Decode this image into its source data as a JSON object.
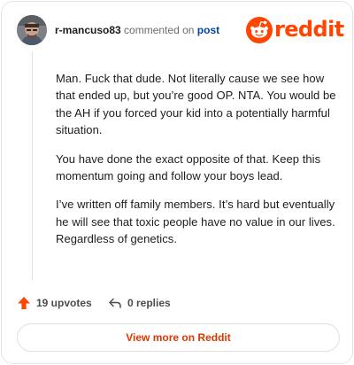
{
  "comment": {
    "username": "r-mancuso83",
    "verb": "commented on",
    "link_text": "post",
    "paragraphs": [
      "Man. Fuck that dude. Not literally cause we see how that ended up, but you’re good OP. NTA. You would be the AH if you forced your kid into a potentially harmful situation.",
      "You have done the exact opposite of that. Keep this momentum going and follow your boys lead.",
      "I’ve written off family members. It’s hard but eventually he will see that toxic people have no value in our lives. Regardless of genetics."
    ]
  },
  "brand": {
    "wordmark": "reddit",
    "color": "#ff4500"
  },
  "actions": {
    "upvotes_label": "19 upvotes",
    "replies_label": "0 replies"
  },
  "cta": {
    "label": "View more on Reddit",
    "color": "#d93a00"
  },
  "icons": [
    "avatar",
    "reddit-snoo-icon",
    "upvote-arrow-icon",
    "reply-arrow-icon"
  ]
}
